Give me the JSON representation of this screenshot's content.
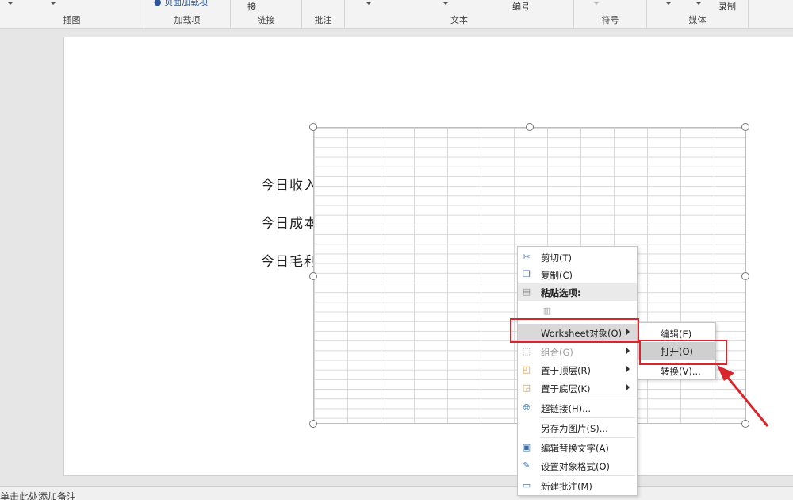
{
  "ribbon": {
    "top_text_1": "页面加载项",
    "top_text_2": "接",
    "top_text_3": "编号",
    "top_text_4": "录制",
    "groups": [
      "插图",
      "加载项",
      "链接",
      "批注",
      "文本",
      "符号",
      "媒体"
    ]
  },
  "slide": {
    "labels": [
      "今日收入:",
      "今日成本:",
      "今日毛利:"
    ]
  },
  "status": {
    "notes": "单击此处添加备注"
  },
  "context_menu": {
    "items": [
      {
        "label": "剪切(T)",
        "icon": "scissors-icon"
      },
      {
        "label": "复制(C)",
        "icon": "copy-icon"
      },
      {
        "label": "粘贴选项:",
        "icon": "paste-icon"
      },
      {
        "label": "Worksheet对象(O)",
        "icon": ""
      },
      {
        "label": "组合(G)",
        "icon": "group-icon"
      },
      {
        "label": "置于顶层(R)",
        "icon": "bring-front-icon"
      },
      {
        "label": "置于底层(K)",
        "icon": "send-back-icon"
      },
      {
        "label": "超链接(H)...",
        "icon": "hyperlink-icon"
      },
      {
        "label": "另存为图片(S)...",
        "icon": ""
      },
      {
        "label": "编辑替换文字(A)",
        "icon": "alt-text-icon"
      },
      {
        "label": "设置对象格式(O)",
        "icon": "format-icon"
      },
      {
        "label": "新建批注(M)",
        "icon": "comment-icon"
      }
    ]
  },
  "submenu": {
    "items": [
      "编辑(E)",
      "打开(O)",
      "转换(V)..."
    ]
  },
  "colors": {
    "highlight": "#d8262c",
    "menu_hover": "#d9d9d9"
  }
}
